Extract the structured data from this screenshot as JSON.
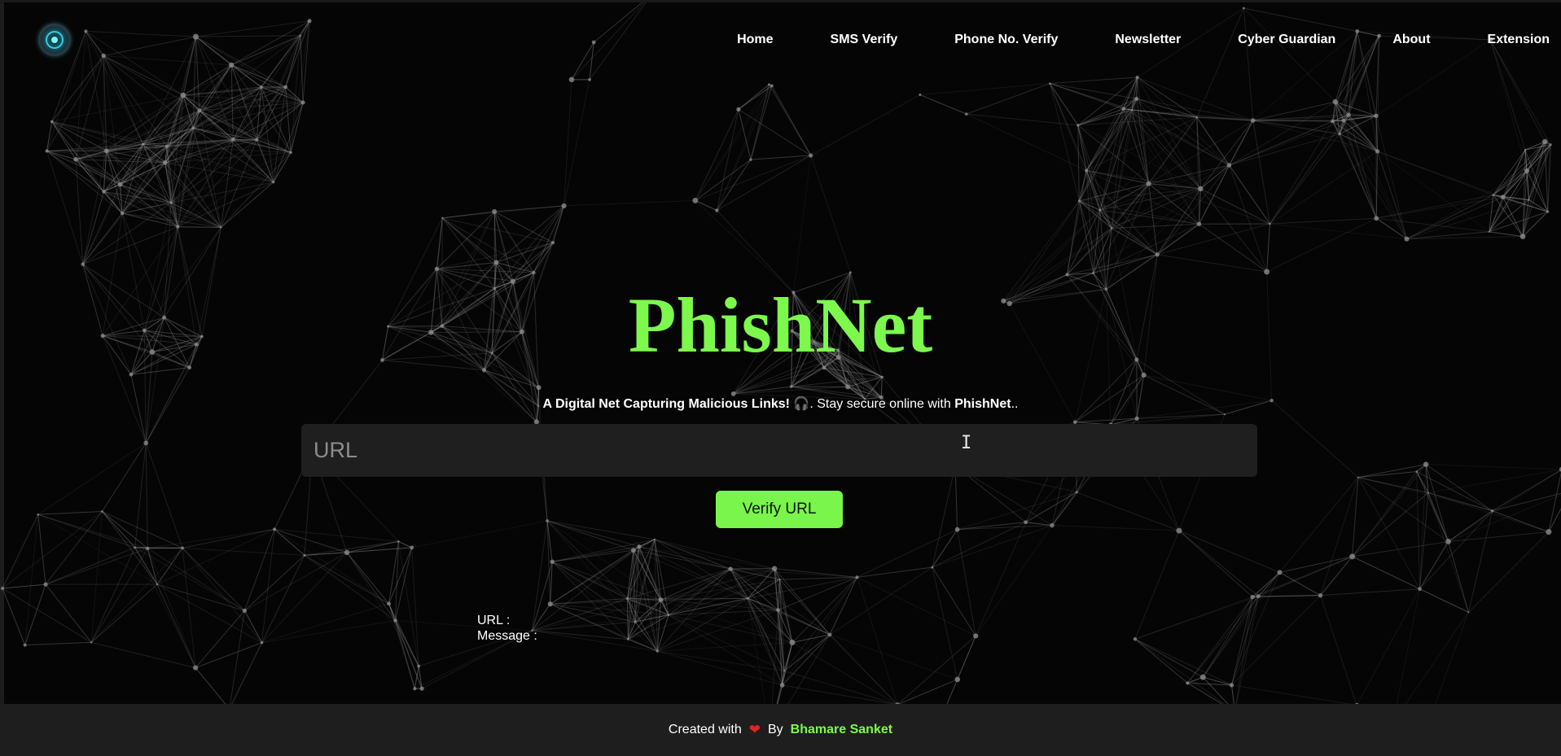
{
  "nav": {
    "items": [
      "Home",
      "SMS Verify",
      "Phone No. Verify",
      "Newsletter",
      "Cyber Guardian",
      "About",
      "Extension"
    ]
  },
  "hero": {
    "title": "PhishNet",
    "tagline_bold": "A Digital Net Capturing Malicious Links!",
    "tagline_emoji": "🎧",
    "tagline_text": ". Stay secure online with",
    "tagline_brand": "PhishNet",
    "tagline_end": ".."
  },
  "search": {
    "placeholder": "URL",
    "value": "",
    "button_label": "Verify URL"
  },
  "result": {
    "url_label": "URL :",
    "message_label": "Message :"
  },
  "footer": {
    "created_with": "Created with",
    "by": "By",
    "author": "Bhamare Sanket"
  },
  "colors": {
    "accent": "#7cf94c",
    "background": "#050505",
    "footer_bg": "#1e1e1e",
    "input_bg": "#1f1f1f",
    "heart": "#e02424"
  },
  "icons": {
    "logo": "phishnet-logo-icon",
    "heart": "heart-icon",
    "cursor": "text-cursor-icon"
  }
}
